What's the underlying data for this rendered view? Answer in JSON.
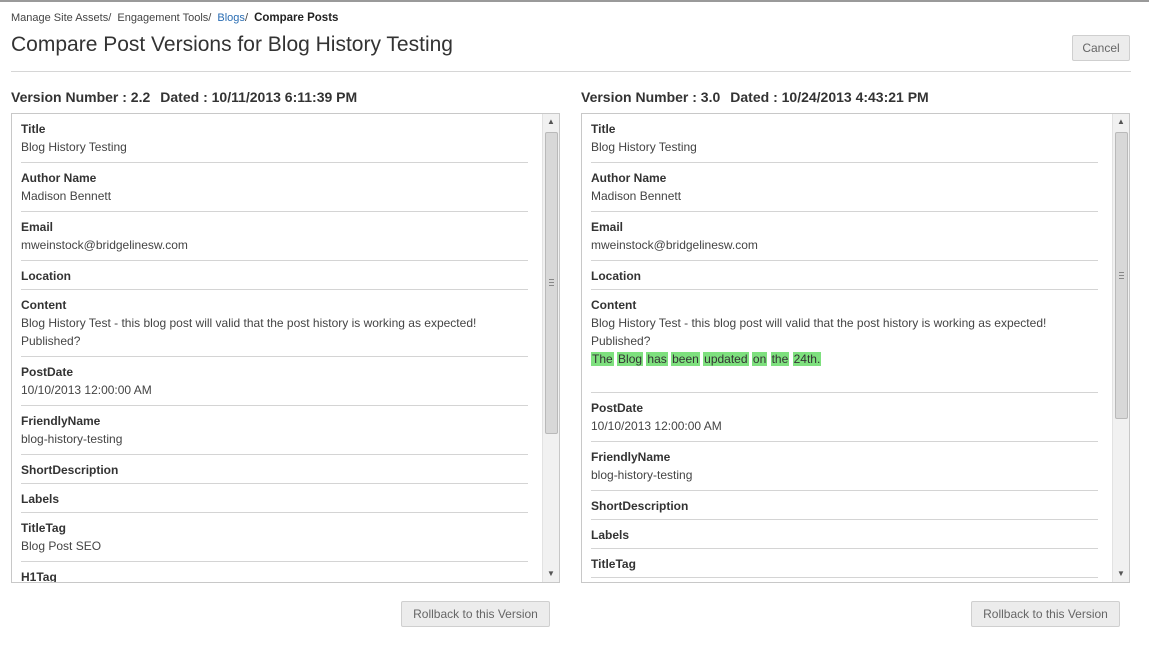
{
  "breadcrumb": {
    "items": [
      "Manage Site Assets",
      "Engagement Tools",
      "Blogs"
    ],
    "separator": "/",
    "current": "Compare Posts"
  },
  "page_title": "Compare Post Versions for Blog History Testing",
  "cancel_label": "Cancel",
  "rollback_label": "Rollback to this Version",
  "left_version": {
    "number_label": "Version Number : 2.2",
    "dated_label": "Dated : 10/11/2013 6:11:39 PM",
    "fields": {
      "title": {
        "label": "Title",
        "value": "Blog History Testing"
      },
      "author": {
        "label": "Author Name",
        "value": "Madison Bennett"
      },
      "email": {
        "label": "Email",
        "value": "mweinstock@bridgelinesw.com"
      },
      "location": {
        "label": "Location"
      },
      "content": {
        "label": "Content",
        "line1": "Blog History Test - this blog post will valid that the post history is working as expected!",
        "line2": "Published?"
      },
      "postdate": {
        "label": "PostDate",
        "value": "10/10/2013 12:00:00 AM"
      },
      "friendlyname": {
        "label": "FriendlyName",
        "value": "blog-history-testing"
      },
      "shortdesc": {
        "label": "ShortDescription"
      },
      "labels": {
        "label": "Labels"
      },
      "titletag": {
        "label": "TitleTag",
        "value": "Blog Post SEO"
      },
      "h1tag": {
        "label": "H1Tag"
      }
    }
  },
  "right_version": {
    "number_label": "Version Number : 3.0",
    "dated_label": "Dated : 10/24/2013 4:43:21 PM",
    "fields": {
      "title": {
        "label": "Title",
        "value": "Blog History Testing"
      },
      "author": {
        "label": "Author Name",
        "value": "Madison Bennett"
      },
      "email": {
        "label": "Email",
        "value": "mweinstock@bridgelinesw.com"
      },
      "location": {
        "label": "Location"
      },
      "content": {
        "label": "Content",
        "line1": "Blog History Test - this blog post will valid that the post history is working as expected!",
        "line2": "Published?",
        "added_words": [
          "The",
          "Blog",
          "has",
          "been",
          "updated",
          "on",
          "the",
          "24th."
        ]
      },
      "postdate": {
        "label": "PostDate",
        "value": "10/10/2013 12:00:00 AM"
      },
      "friendlyname": {
        "label": "FriendlyName",
        "value": "blog-history-testing"
      },
      "shortdesc": {
        "label": "ShortDescription"
      },
      "labels": {
        "label": "Labels"
      },
      "titletag": {
        "label": "TitleTag"
      }
    }
  },
  "colors": {
    "added_highlight": "#7ee07e",
    "link": "#2a6db3"
  },
  "icons": {
    "scroll_up": "scroll-up-arrow-icon",
    "scroll_down": "scroll-down-arrow-icon"
  }
}
